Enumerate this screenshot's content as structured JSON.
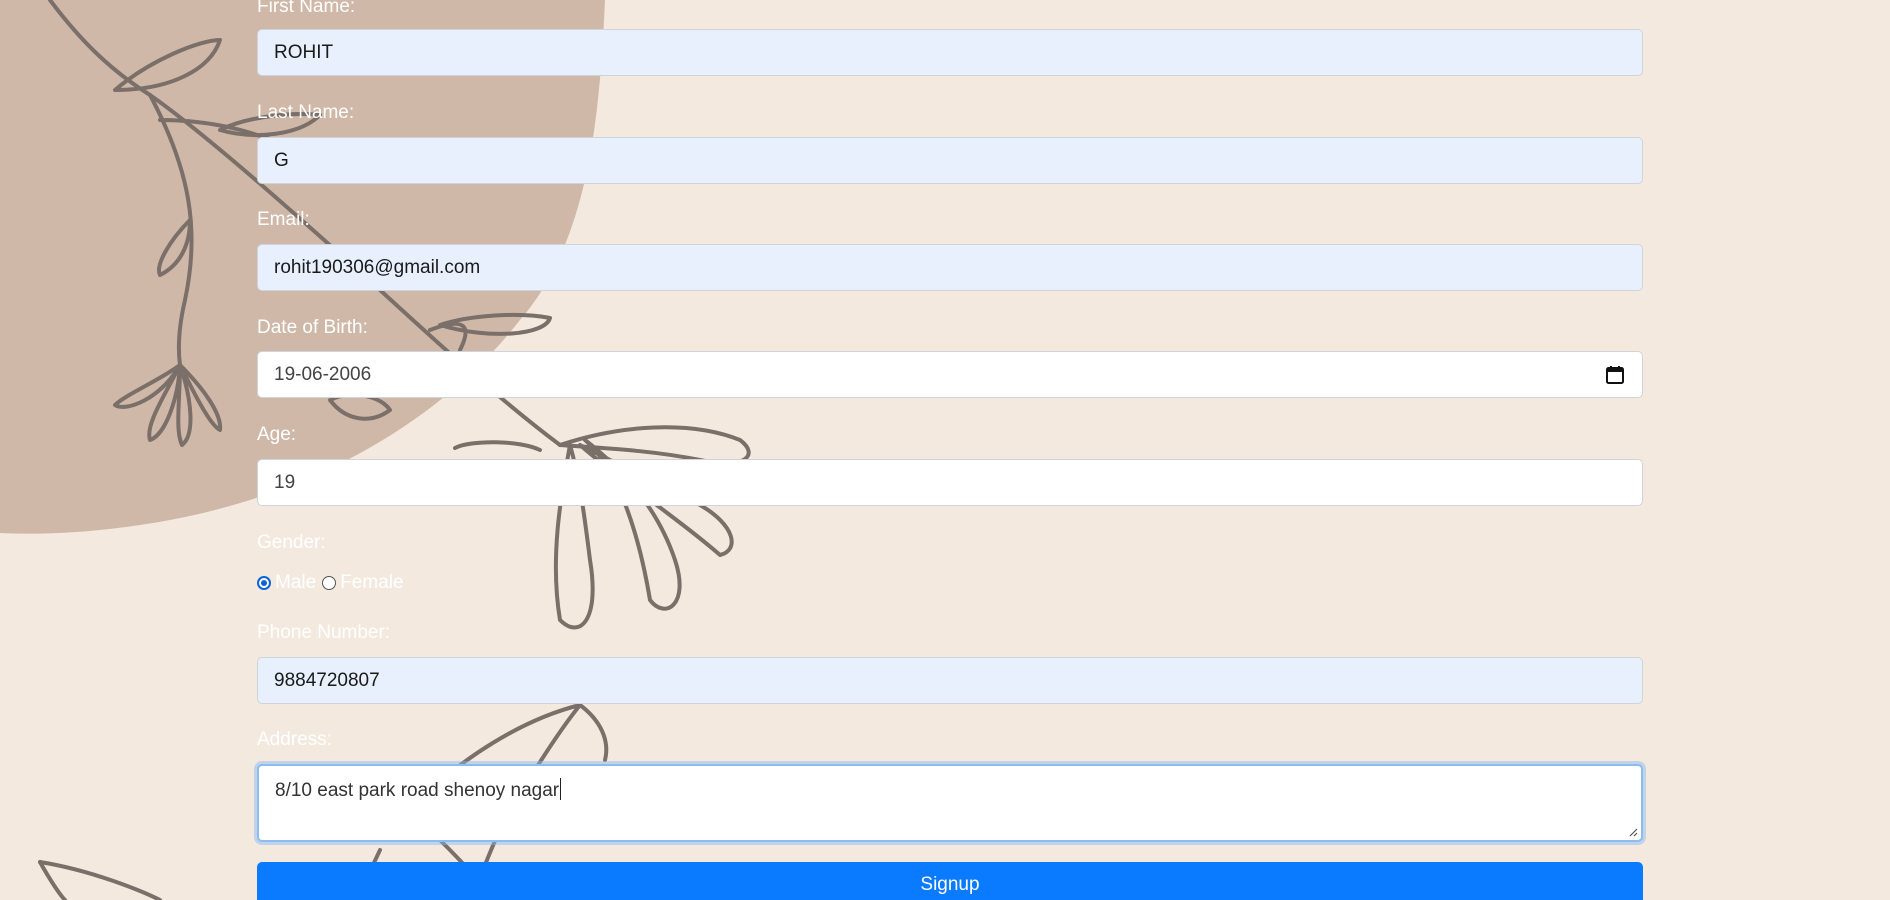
{
  "form": {
    "first_name": {
      "label": "First Name:",
      "value": "ROHIT"
    },
    "last_name": {
      "label": "Last Name:",
      "value": "G"
    },
    "email": {
      "label": "Email:",
      "value": "rohit190306@gmail.com"
    },
    "dob": {
      "label": "Date of Birth:",
      "value": "19-06-2006",
      "icon": "calendar-icon"
    },
    "age": {
      "label": "Age:",
      "value": "19"
    },
    "gender": {
      "label": "Gender:",
      "options": [
        {
          "label": "Male",
          "checked": true
        },
        {
          "label": "Female",
          "checked": false
        }
      ]
    },
    "phone": {
      "label": "Phone Number:",
      "value": "9884720807"
    },
    "address": {
      "label": "Address:",
      "value": "8/10 east park road shenoy nagar"
    },
    "submit_label": "Signup"
  },
  "colors": {
    "background": "#f4e9df",
    "blob": "#d0b8a8",
    "line_art": "#7a6f69",
    "autofill": "#e8f0fe",
    "button": "#0a7aff",
    "focus_ring": "#8cbcf0"
  }
}
